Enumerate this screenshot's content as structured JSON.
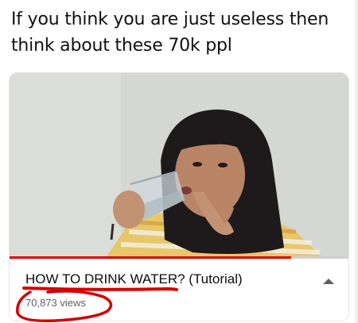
{
  "caption": "If you think you are just useless then think about these 70k ppl",
  "video": {
    "title": "HOW TO DRINK WATER? (Tutorial)",
    "views": "70,873 views",
    "progress_fraction": 0.83,
    "expand_icon": "chevron-up-icon"
  },
  "colors": {
    "progress": "#e00000",
    "annotation": "#d40000",
    "title_text": "#0d0d0d",
    "meta_text": "#606060"
  }
}
